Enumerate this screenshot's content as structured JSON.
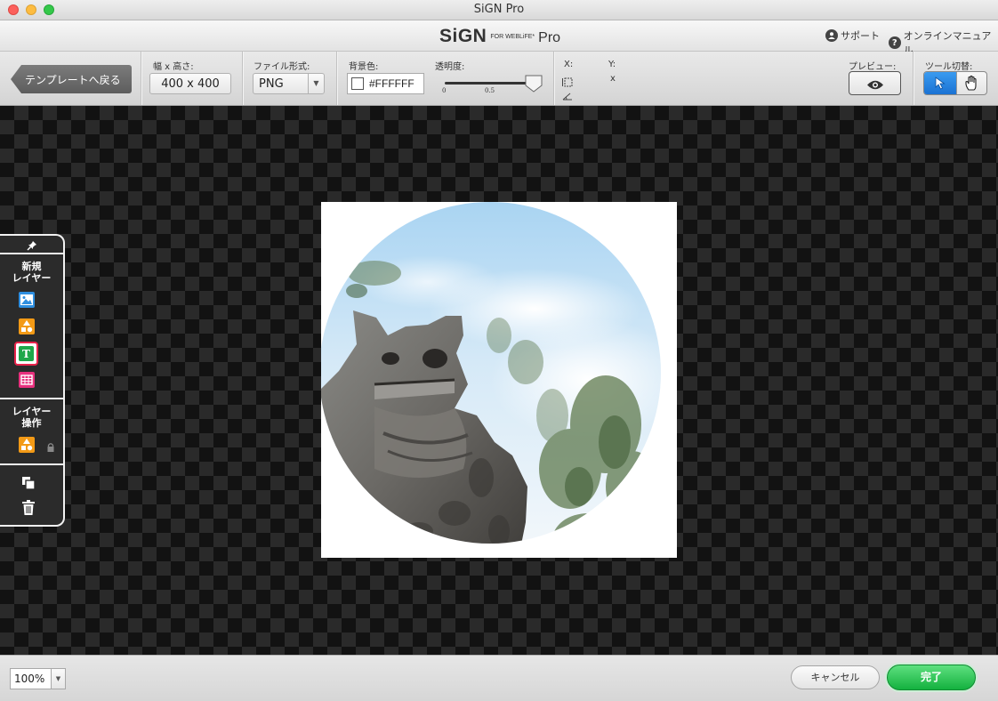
{
  "window": {
    "title": "SiGN Pro"
  },
  "header": {
    "logo_main": "SiGN",
    "logo_for": "FOR WEBLiFE*",
    "logo_pro": "Pro",
    "support_label": "サポート",
    "manual_label": "オンラインマニュアル"
  },
  "toolbar": {
    "back_label": "テンプレートへ戻る",
    "size_label": "幅 x 高さ:",
    "size_value": "400 x 400",
    "format_label": "ファイル形式:",
    "format_value": "PNG",
    "bgcolor_label": "背景色:",
    "bgcolor_value": "#FFFFFF",
    "opacity_label": "透明度:",
    "opacity_min": "0",
    "opacity_mid": "0.5",
    "opacity_value": 0.9,
    "x_label": "X:",
    "y_label": "Y:",
    "x_sep": "x",
    "preview_label": "プレビュー:",
    "tool_switch_label": "ツール切替:"
  },
  "side_panel": {
    "new_layer_label": "新規\nレイヤー",
    "layer_ops_label": "レイヤー\n操作"
  },
  "bottom": {
    "zoom_value": "100%",
    "cancel_label": "キャンセル",
    "done_label": "完了"
  },
  "colors": {
    "accent_blue": "#1a72d3",
    "done_green": "#14b13f",
    "highlight_red": "#e8234a",
    "icon_blue": "#2f8fe0",
    "icon_orange": "#f39a16",
    "icon_green": "#1fa74a",
    "icon_pink": "#e8317e"
  }
}
